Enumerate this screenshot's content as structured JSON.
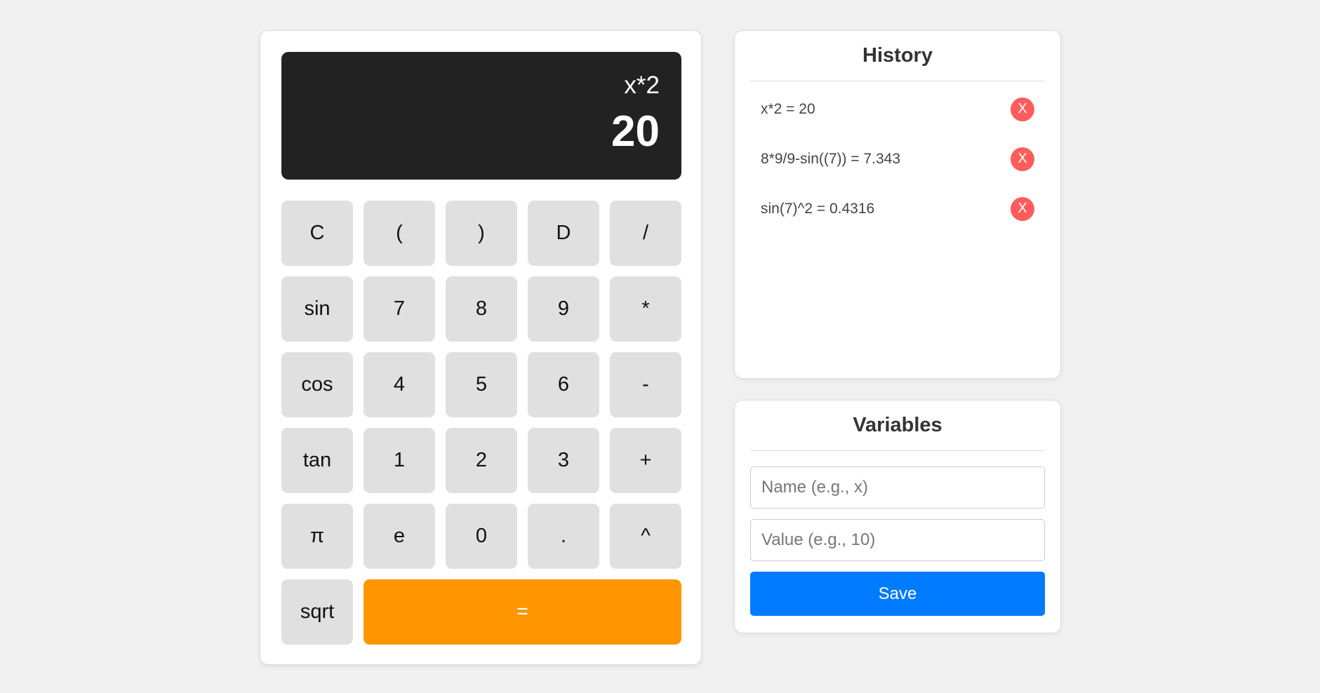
{
  "calculator": {
    "display": {
      "expression": "x*2",
      "result": "20"
    },
    "keys": [
      [
        "C",
        "(",
        ")",
        "D",
        "/"
      ],
      [
        "sin",
        "7",
        "8",
        "9",
        "*"
      ],
      [
        "cos",
        "4",
        "5",
        "6",
        "-"
      ],
      [
        "tan",
        "1",
        "2",
        "3",
        "+"
      ],
      [
        "π",
        "e",
        "0",
        ".",
        "^"
      ]
    ],
    "last_row": {
      "sqrt": "sqrt",
      "equals": "="
    }
  },
  "history": {
    "title": "History",
    "items": [
      {
        "text": "x*2 = 20",
        "delete_label": "X"
      },
      {
        "text": "8*9/9-sin((7)) = 7.343",
        "delete_label": "X"
      },
      {
        "text": "sin(7)^2 = 0.4316",
        "delete_label": "X"
      }
    ]
  },
  "variables": {
    "title": "Variables",
    "name_placeholder": "Name (e.g., x)",
    "value_placeholder": "Value (e.g., 10)",
    "save_label": "Save"
  },
  "colors": {
    "display_bg": "#222222",
    "equals_accent": "#ff9500",
    "save_accent": "#007bff",
    "delete_accent": "#ff5c5c"
  }
}
